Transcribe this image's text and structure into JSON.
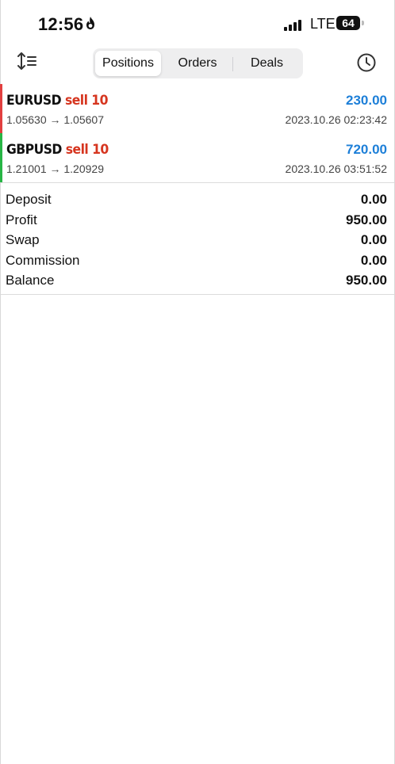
{
  "status_bar": {
    "time": "12:56",
    "network": "LTE",
    "battery": "64"
  },
  "toolbar": {
    "tabs": [
      {
        "label": "Positions",
        "active": true
      },
      {
        "label": "Orders",
        "active": false
      },
      {
        "label": "Deals",
        "active": false
      }
    ]
  },
  "positions": [
    {
      "symbol": "EURUSD",
      "type": "sell 10",
      "profit": "230.00",
      "prices": "1.05630 → 1.05607",
      "time": "2023.10.26 02:23:42",
      "indicator_color": "#e23f3f"
    },
    {
      "symbol": "GBPUSD",
      "type": "sell 10",
      "profit": "720.00",
      "prices": "1.21001 → 1.20929",
      "time": "2023.10.26 03:51:52",
      "indicator_color": "#27b545"
    }
  ],
  "summary": [
    {
      "label": "Deposit",
      "value": "0.00"
    },
    {
      "label": "Profit",
      "value": "950.00"
    },
    {
      "label": "Swap",
      "value": "0.00"
    },
    {
      "label": "Commission",
      "value": "0.00"
    },
    {
      "label": "Balance",
      "value": "950.00"
    }
  ],
  "colors": {
    "profit_blue": "#1d7fd8",
    "sell_red": "#d6351f"
  },
  "icons": {
    "sort": "sort-icon",
    "history": "clock-icon",
    "flame": "flame-icon"
  }
}
